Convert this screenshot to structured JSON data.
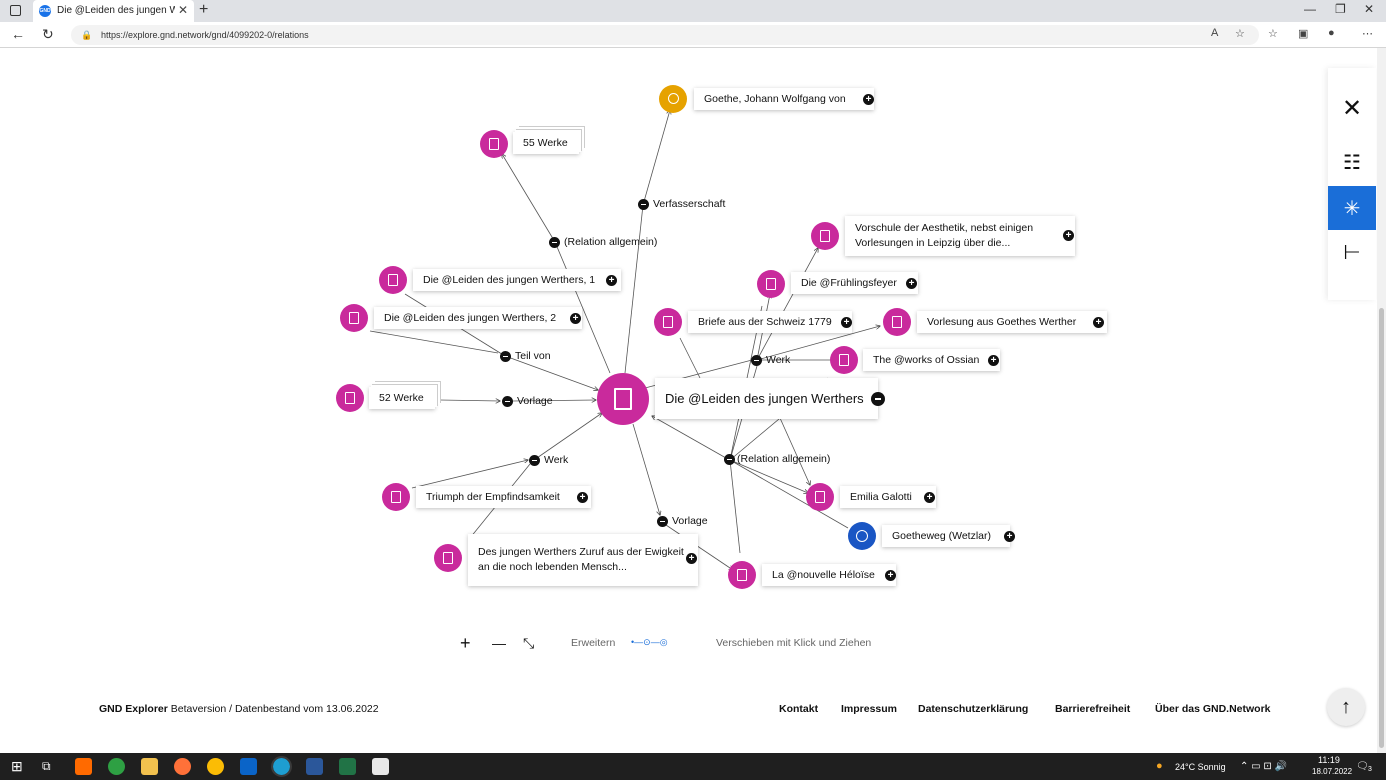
{
  "browser": {
    "tab_title": "Die @Leiden des jungen Werthe",
    "favicon_text": "GND",
    "url": "https://explore.gnd.network/gnd/4099202-0/relations"
  },
  "graph": {
    "center": {
      "title": "Die @Leiden des jungen Werthers"
    },
    "nodes": [
      {
        "label": "Goethe, Johann Wolfgang von"
      },
      {
        "label": "55 Werke"
      },
      {
        "label": "Die @Leiden des jungen Werthers, 1"
      },
      {
        "label": "Die @Leiden des jungen Werthers, 2"
      },
      {
        "label": "52 Werke"
      },
      {
        "label": "Triumph der Empfindsamkeit"
      },
      {
        "label": "Des jungen Werthers Zuruf aus der Ewigkeit an die noch lebenden Mensch..."
      },
      {
        "label": "Vorschule der Aesthetik, nebst einigen Vorlesungen in Leipzig über die..."
      },
      {
        "label": "Die @Frühlingsfeyer"
      },
      {
        "label": "Briefe aus der Schweiz 1779"
      },
      {
        "label": "Vorlesung aus Goethes Werther"
      },
      {
        "label": "The @works of Ossian"
      },
      {
        "label": "Emilia Galotti"
      },
      {
        "label": "Goetheweg (Wetzlar)"
      },
      {
        "label": "La @nouvelle Héloïse"
      }
    ],
    "relations": [
      {
        "label": "Verfasserschaft"
      },
      {
        "label": "(Relation allgemein)"
      },
      {
        "label": "Teil von"
      },
      {
        "label": "Vorlage"
      },
      {
        "label": "Werk"
      },
      {
        "label": "Vorlage"
      },
      {
        "label": "Werk"
      },
      {
        "label": "(Relation allgemein)"
      }
    ]
  },
  "controls": {
    "zoom_in": "+",
    "zoom_out": "—",
    "expand_label": "Erweitern",
    "hint": "Verschieben mit Klick und Ziehen"
  },
  "footer": {
    "brand": "GND Explorer",
    "version_text": "Betaversion / Datenbestand vom 13.06.2022",
    "links": [
      "Kontakt",
      "Impressum",
      "Datenschutzerklärung",
      "Barrierefreiheit",
      "Über das GND.Network"
    ]
  },
  "sidepanel": {
    "items": [
      "close-icon",
      "list-view-icon",
      "graph-view-icon",
      "hierarchy-view-icon"
    ],
    "accent_color": "#1a6ed8"
  },
  "taskbar": {
    "weather": "24°C  Sonnig",
    "time": "11:19",
    "date": "18.07.2022",
    "notifications": "3"
  },
  "colors": {
    "work_node": "#c92a9c",
    "person_node": "#e6a200",
    "place_node": "#1a56c4"
  }
}
